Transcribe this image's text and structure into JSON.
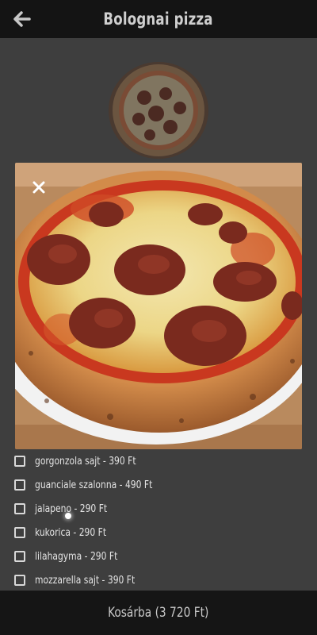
{
  "header": {
    "title": "Bolognai pizza",
    "back_icon": "arrow-left-icon"
  },
  "modal": {
    "close_icon": "close-icon",
    "image_alt": "Bolognai pizza"
  },
  "extras": [
    {
      "label": "gorgonzola sajt - 390 Ft",
      "checked": false
    },
    {
      "label": "guanciale szalonna - 490 Ft",
      "checked": false
    },
    {
      "label": "jalapeno - 290 Ft",
      "checked": false
    },
    {
      "label": "kukorica - 290 Ft",
      "checked": false
    },
    {
      "label": "lilahagyma - 290 Ft",
      "checked": false
    },
    {
      "label": "mozzarella sajt - 390 Ft",
      "checked": false
    }
  ],
  "cart": {
    "button_label": "Kosárba (3 720 Ft)"
  },
  "colors": {
    "header_bg": "#141414",
    "overlay_bg": "#3e3e3e",
    "cart_bg": "#151515"
  }
}
